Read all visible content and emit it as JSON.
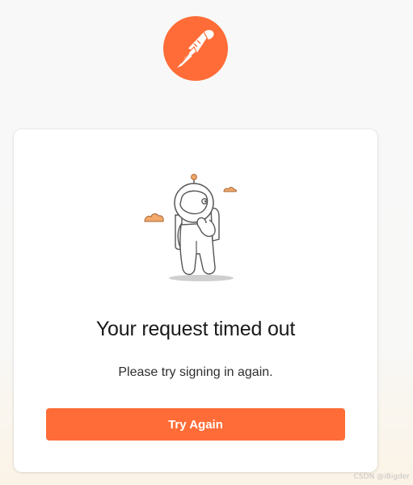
{
  "logo": {
    "icon": "postman-rocketman-icon",
    "color": "#ff6c37"
  },
  "illustration": {
    "icon": "astronaut-thinking-icon",
    "accent": "#f2a869"
  },
  "dialog": {
    "title": "Your request timed out",
    "message": "Please try signing in again.",
    "button_label": "Try Again"
  },
  "watermark": "CSDN @iBigder",
  "colors": {
    "accent": "#ff6c37",
    "background": "#f8f8f8"
  }
}
